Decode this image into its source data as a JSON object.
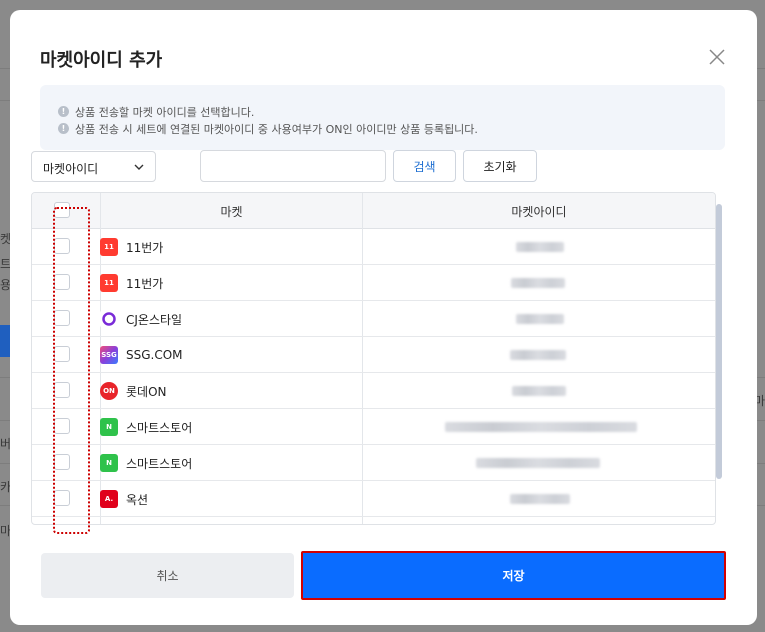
{
  "background": {
    "hints": [
      "켓",
      "트",
      "용",
      "버",
      "카",
      "마",
      "마"
    ]
  },
  "modal": {
    "title": "마켓아이디 추가",
    "info": [
      "상품 전송할 마켓 아이디를 선택합니다.",
      "상품 전송 시 세트에 연결된 마켓아이디 중 사용여부가 ON인 아이디만 상품 등록됩니다."
    ],
    "filter": {
      "select_value": "마켓아이디",
      "search_placeholder": "",
      "search_label": "검색",
      "reset_label": "초기화"
    },
    "table": {
      "columns": [
        "마켓",
        "마켓아이디"
      ],
      "rows": [
        {
          "market": "11번가",
          "logo": "11st-logo",
          "logo_text": "11",
          "logo_color": "#ff3b30"
        },
        {
          "market": "11번가",
          "logo": "11st-logo",
          "logo_text": "11",
          "logo_color": "#ff3b30"
        },
        {
          "market": "CJ온스타일",
          "logo": "cj-onstyle-logo",
          "logo_text": "",
          "logo_color": "#7a2bd8"
        },
        {
          "market": "SSG.COM",
          "logo": "ssg-logo",
          "logo_text": "SSG",
          "logo_color": "#e8315f"
        },
        {
          "market": "롯데ON",
          "logo": "lotteon-logo",
          "logo_text": "ON",
          "logo_color": "#e8242a"
        },
        {
          "market": "스마트스토어",
          "logo": "smartstore-logo",
          "logo_text": "N",
          "logo_color": "#2fc24b"
        },
        {
          "market": "스마트스토어",
          "logo": "smartstore-logo",
          "logo_text": "N",
          "logo_color": "#2fc24b"
        },
        {
          "market": "옥션",
          "logo": "auction-logo",
          "logo_text": "A.",
          "logo_color": "#e0001b"
        }
      ]
    },
    "buttons": {
      "cancel": "취소",
      "save": "저장"
    }
  },
  "colors": {
    "primary": "#0a6cff",
    "highlight_border": "#d20000",
    "link_blue": "#1f6fd1"
  }
}
